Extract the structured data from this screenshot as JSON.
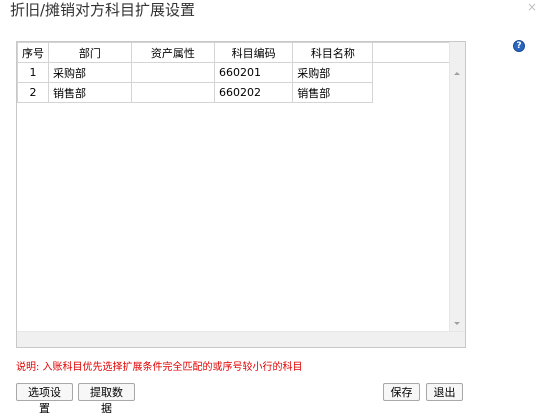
{
  "dialog": {
    "title": "折旧/摊销对方科目扩展设置",
    "close_glyph": "×"
  },
  "help": {
    "icon": "help-icon",
    "glyph": "?"
  },
  "grid": {
    "columns": [
      "序号",
      "部门",
      "资产属性",
      "科目编码",
      "科目名称"
    ],
    "rows": [
      {
        "seq": "1",
        "dept": "采购部",
        "asset_attr": "",
        "code": "660201",
        "name": "采购部"
      },
      {
        "seq": "2",
        "dept": "销售部",
        "asset_attr": "",
        "code": "660202",
        "name": "销售部"
      }
    ]
  },
  "note": "说明: 入账科目优先选择扩展条件完全匹配的或序号较小行的科目",
  "buttons": {
    "options": "选项设置",
    "fetch": "提取数据",
    "save": "保存",
    "exit": "退出"
  }
}
